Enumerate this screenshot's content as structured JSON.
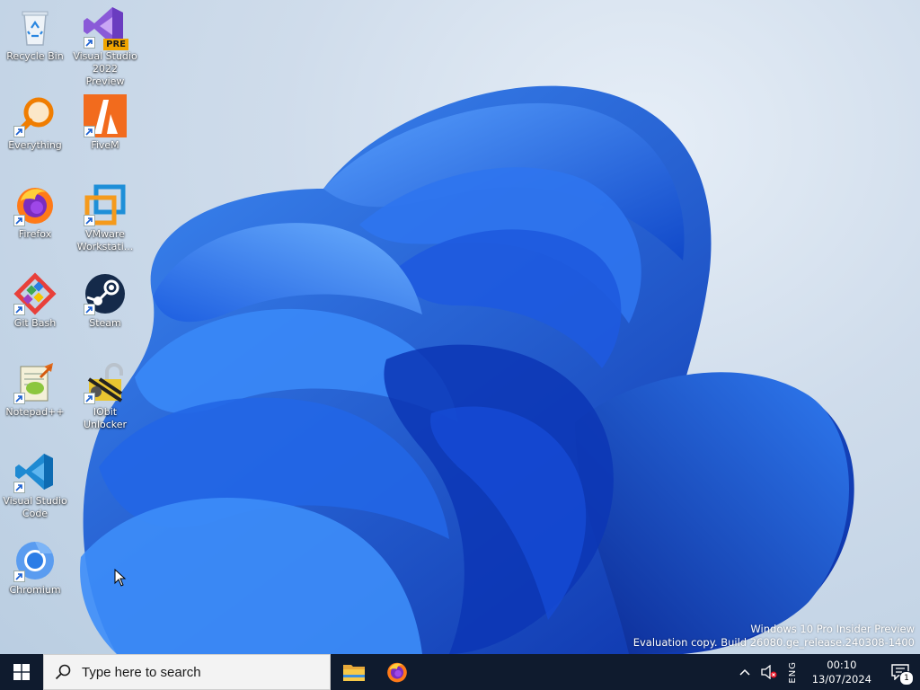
{
  "desktop": {
    "icons": [
      {
        "label": "Recycle Bin",
        "icon": "recycle-bin-icon"
      },
      {
        "label": "Visual Studio 2022 Preview",
        "icon": "visual-studio-icon",
        "badge": "PRE"
      },
      {
        "label": "Everything",
        "icon": "everything-search-icon"
      },
      {
        "label": "FiveM",
        "icon": "fivem-icon"
      },
      {
        "label": "Firefox",
        "icon": "firefox-icon"
      },
      {
        "label": "VMware Workstati...",
        "icon": "vmware-icon"
      },
      {
        "label": "Git Bash",
        "icon": "git-bash-icon"
      },
      {
        "label": "Steam",
        "icon": "steam-icon"
      },
      {
        "label": "Notepad++",
        "icon": "notepad-plus-plus-icon"
      },
      {
        "label": "IObit Unlocker",
        "icon": "iobit-unlocker-icon"
      },
      {
        "label": "Visual Studio Code",
        "icon": "vscode-icon"
      },
      {
        "label": "Chromium",
        "icon": "chromium-icon"
      }
    ],
    "watermark": {
      "line1": "Windows 10 Pro Insider Preview",
      "line2": "Evaluation copy. Build 26080.ge_release.240308-1400"
    }
  },
  "taskbar": {
    "search_placeholder": "Type here to search",
    "pinned": [
      {
        "name": "File Explorer",
        "icon": "file-explorer-icon"
      },
      {
        "name": "Firefox",
        "icon": "firefox-icon"
      }
    ],
    "tray": {
      "language": "ENG",
      "time": "00:10",
      "date": "13/07/2024",
      "notification_count": "1"
    }
  },
  "colors": {
    "taskbar_bg": "#0f1b2e",
    "wallpaper_blue": "#1a5fe0",
    "accent": "#0078d4"
  }
}
